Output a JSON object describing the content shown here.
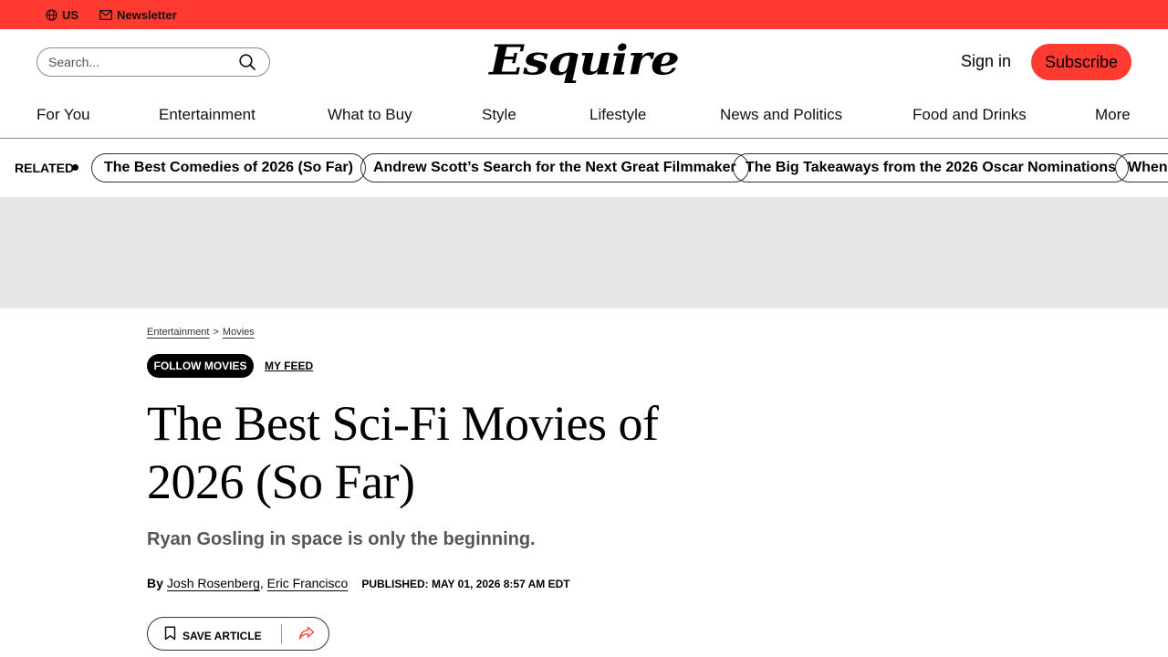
{
  "topbar": {
    "region_label": "US",
    "newsletter_label": "Newsletter",
    "background_color": "#ff3a30"
  },
  "header": {
    "search_placeholder": "Search...",
    "logo_text": "Esquire",
    "signin_label": "Sign in",
    "subscribe_label": "Subscribe",
    "subscribe_color": "#ff3a30"
  },
  "nav": {
    "items": [
      {
        "label": "For You"
      },
      {
        "label": "Entertainment"
      },
      {
        "label": "What to Buy"
      },
      {
        "label": "Style"
      },
      {
        "label": "Lifestyle"
      },
      {
        "label": "News and Politics"
      },
      {
        "label": "Food and Drinks"
      },
      {
        "label": "More"
      }
    ]
  },
  "related": {
    "label": "RELATED",
    "items": [
      {
        "label": "The Best Comedies of 2026 (So Far)"
      },
      {
        "label": "Andrew Scott’s Search for the Next Great Filmmaker"
      },
      {
        "label": "The Big Takeaways from the 2026 Oscar Nominations"
      },
      {
        "label": "When"
      }
    ]
  },
  "article": {
    "breadcrumbs": [
      "Entertainment",
      ">",
      "Movies"
    ],
    "follow_label": "FOLLOW MOVIES",
    "myfeed_label": "MY FEED",
    "headline": "The Best Sci-Fi Movies of 2026 (So Far)",
    "dek": "Ryan Gosling in space is only the beginning.",
    "byline_prefix": "By",
    "authors": [
      "Josh Rosenberg",
      "Eric Francisco"
    ],
    "author_separator": ",",
    "published": "PUBLISHED: MAY 01, 2026 8:57 AM EDT",
    "save_label": "SAVE ARTICLE",
    "share_icon_color": "#ff3a30"
  },
  "icons": {
    "globe": "globe-icon",
    "mail": "mail-icon",
    "search": "search-icon",
    "bookmark": "bookmark-icon",
    "share": "share-icon"
  }
}
